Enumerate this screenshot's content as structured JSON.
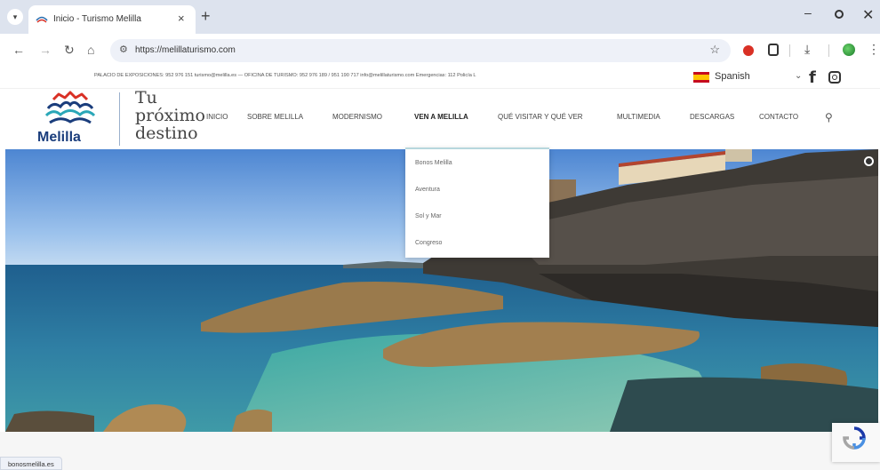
{
  "browser": {
    "tab_title": "Inicio - Turismo Melilla",
    "tab_close": "×",
    "new_tab": "+",
    "url": "https://melillaturismo.com",
    "minimize": "–",
    "close": "✕"
  },
  "topbar": {
    "info": "PALACIO DE EXPOSICIONES: 952 976 151 turismo@melilla.es — OFICINA DE TURISMO: 952 976 189 / 951 190 717 info@melillaturismo.com Emergencias: 112 Policía L",
    "language": "Spanish"
  },
  "header": {
    "logo_text": "Melilla",
    "tagline_line1": "Tu",
    "tagline_line2": "próximo",
    "tagline_line3": "destino"
  },
  "nav": {
    "items": [
      {
        "label": "INICIO"
      },
      {
        "label": "SOBRE MELILLA"
      },
      {
        "label": "MODERNISMO"
      },
      {
        "label": "VEN A MELILLA"
      },
      {
        "label": "QUÉ VISITAR Y QUÉ VER"
      },
      {
        "label": "MULTIMEDIA"
      },
      {
        "label": "DESCARGAS"
      },
      {
        "label": "CONTACTO"
      }
    ]
  },
  "dropdown": {
    "items": [
      {
        "label": "Bonos Melilla"
      },
      {
        "label": "Aventura"
      },
      {
        "label": "Sol y Mar"
      },
      {
        "label": "Congreso"
      }
    ]
  },
  "status": {
    "url": "bonosmelilla.es"
  },
  "colors": {
    "brand_blue": "#1a3d7c",
    "logo_red": "#d93025",
    "logo_teal": "#2aa7b8",
    "dropdown_accent": "#b7d7dd"
  },
  "icons": [
    "tab-list-icon",
    "back-icon",
    "forward-icon",
    "reload-icon",
    "home-icon",
    "site-settings-icon",
    "star-icon",
    "download-icon",
    "kebab-icon",
    "facebook-icon",
    "instagram-icon",
    "search-icon",
    "recaptcha-icon"
  ]
}
